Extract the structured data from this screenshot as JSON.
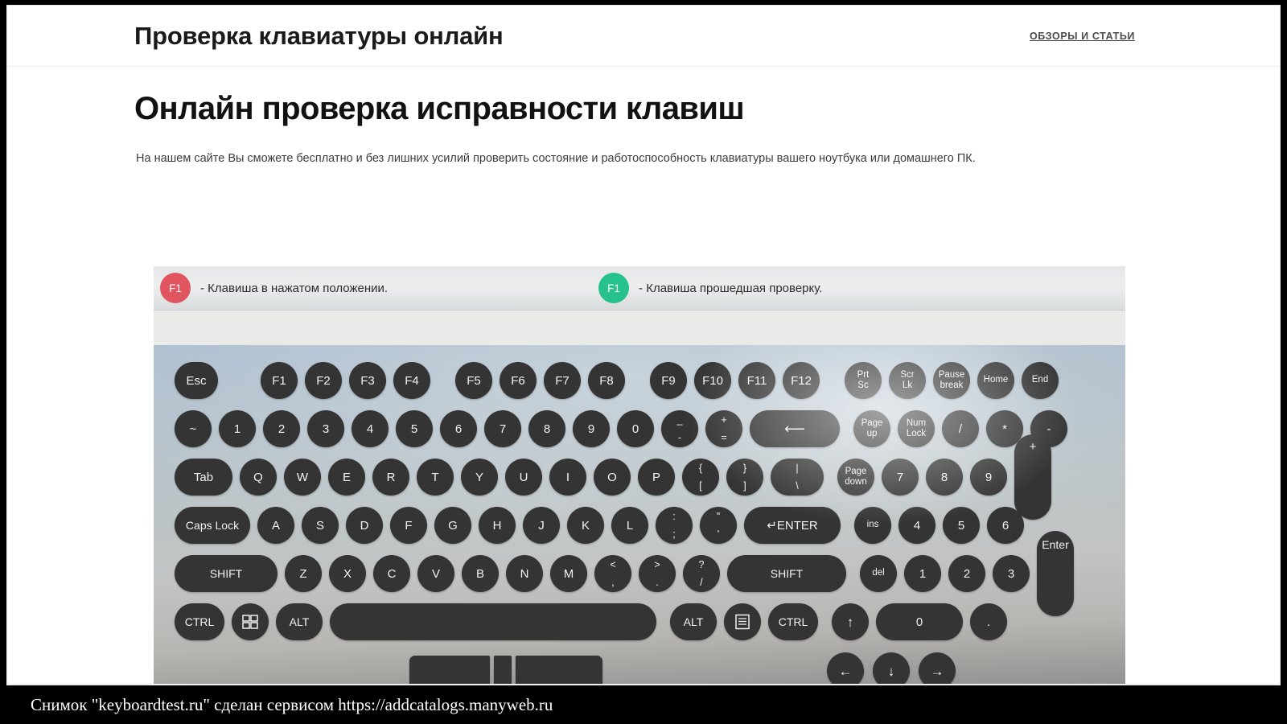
{
  "header": {
    "site_title": "Проверка клавиатуры онлайн",
    "nav_link": "ОБЗОРЫ И СТАТЬИ"
  },
  "main": {
    "page_title": "Онлайн проверка исправности клавиш",
    "description": "На нашем сайте Вы сможете бесплатно и без лишних усилий проверить состояние и работоспособность клавиатуры вашего ноутбука или домашнего ПК."
  },
  "legend": {
    "pressed": {
      "key_label": "F1",
      "text": "- Клавиша в нажатом положении.",
      "color": "#e0555f"
    },
    "tested": {
      "key_label": "F1",
      "text": "- Клавиша прошедшая проверку.",
      "color": "#27c18c"
    }
  },
  "keyboard": {
    "row_fn": {
      "esc": "Esc",
      "f1": "F1",
      "f2": "F2",
      "f3": "F3",
      "f4": "F4",
      "f5": "F5",
      "f6": "F6",
      "f7": "F7",
      "f8": "F8",
      "f9": "F9",
      "f10": "F10",
      "f11": "F11",
      "f12": "F12",
      "prtsc_1": "Prt",
      "prtsc_2": "Sc",
      "scrlk_1": "Scr",
      "scrlk_2": "Lk",
      "pause_1": "Pause",
      "pause_2": "break",
      "home": "Home",
      "end": "End"
    },
    "row_num": {
      "tilde": "~",
      "d1": "1",
      "d2": "2",
      "d3": "3",
      "d4": "4",
      "d5": "5",
      "d6": "6",
      "d7": "7",
      "d8": "8",
      "d9": "9",
      "d0": "0",
      "minus_top": "_",
      "minus_bot": "-",
      "plus_top": "+",
      "plus_bot": "=",
      "backspace": "⟵",
      "pageup_1": "Page",
      "pageup_2": "up",
      "numlock_1": "Num",
      "numlock_2": "Lock",
      "np_div": "/",
      "np_mul": "*",
      "np_sub": "-"
    },
    "row_qwerty": {
      "tab": "Tab",
      "q": "Q",
      "w": "W",
      "e": "E",
      "r": "R",
      "t": "T",
      "y": "Y",
      "u": "U",
      "i": "I",
      "o": "O",
      "p": "P",
      "br_open_top": "{",
      "br_open_bot": "[",
      "br_close_top": "}",
      "br_close_bot": "]",
      "pipe_top": "|",
      "pipe_bot": "\\",
      "pagedown_1": "Page",
      "pagedown_2": "down",
      "np7": "7",
      "np8": "8",
      "np9": "9",
      "np_plus": "+"
    },
    "row_home": {
      "capslock": "Caps Lock",
      "a": "A",
      "s": "S",
      "d": "D",
      "f": "F",
      "g": "G",
      "h": "H",
      "j": "J",
      "k": "K",
      "l": "L",
      "semi_top": ":",
      "semi_bot": ";",
      "quote_top": "\"",
      "quote_bot": "'",
      "enter": "↵ENTER",
      "ins": "ins",
      "np4": "4",
      "np5": "5",
      "np6": "6"
    },
    "row_shift": {
      "shift_left": "SHIFT",
      "z": "Z",
      "x": "X",
      "c": "C",
      "v": "V",
      "b": "B",
      "n": "N",
      "m": "M",
      "comma_top": "<",
      "comma_bot": ",",
      "period_top": ">",
      "period_bot": ".",
      "slash_top": "?",
      "slash_bot": "/",
      "shift_right": "SHIFT",
      "del": "del",
      "np1": "1",
      "np2": "2",
      "np3": "3"
    },
    "row_bottom": {
      "ctrl_left": "CTRL",
      "win": "win-icon",
      "alt_left": "ALT",
      "space": "",
      "alt_right": "ALT",
      "menu": "menu-icon",
      "ctrl_right": "CTRL",
      "arrow_up": "↑",
      "np0": "0",
      "np_dot": ".",
      "np_enter": "Enter"
    },
    "row_arrows": {
      "arrow_left": "←",
      "arrow_down": "↓",
      "arrow_right": "→"
    }
  },
  "watermark": {
    "text": "Снимок \"keyboardtest.ru\" сделан сервисом https://addcatalogs.manyweb.ru"
  }
}
